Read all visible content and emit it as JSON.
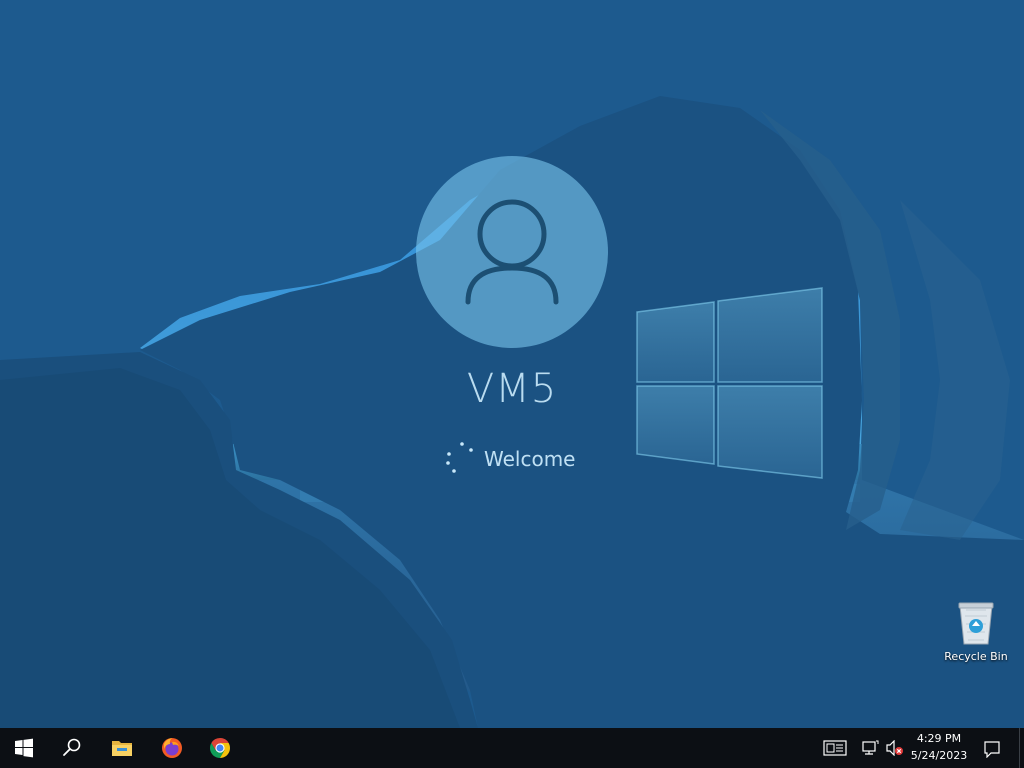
{
  "lock_screen": {
    "user_name": "VM5",
    "status_text": "Welcome",
    "avatar_icon": "user-silhouette-icon"
  },
  "desktop": {
    "icons": [
      {
        "label": "Recycle Bin",
        "icon": "recycle-bin-icon"
      }
    ]
  },
  "taskbar": {
    "start_icon": "windows-logo-icon",
    "search_icon": "search-icon",
    "pinned": [
      {
        "name": "File Explorer",
        "icon": "folder-icon"
      },
      {
        "name": "Firefox",
        "icon": "firefox-icon"
      },
      {
        "name": "Chrome",
        "icon": "chrome-icon"
      }
    ],
    "tray": {
      "icons": [
        "news-and-interests-icon",
        "network-icon",
        "volume-muted-icon"
      ],
      "time": "4:29 PM",
      "date": "5/24/2023",
      "notification_icon": "action-center-icon"
    }
  },
  "colors": {
    "taskbar_bg": "#0c0f14",
    "overlay_blue": "#1d6fb8",
    "avatar_fill": "#78c4ec",
    "welcome_text": "#c8e8fa"
  }
}
